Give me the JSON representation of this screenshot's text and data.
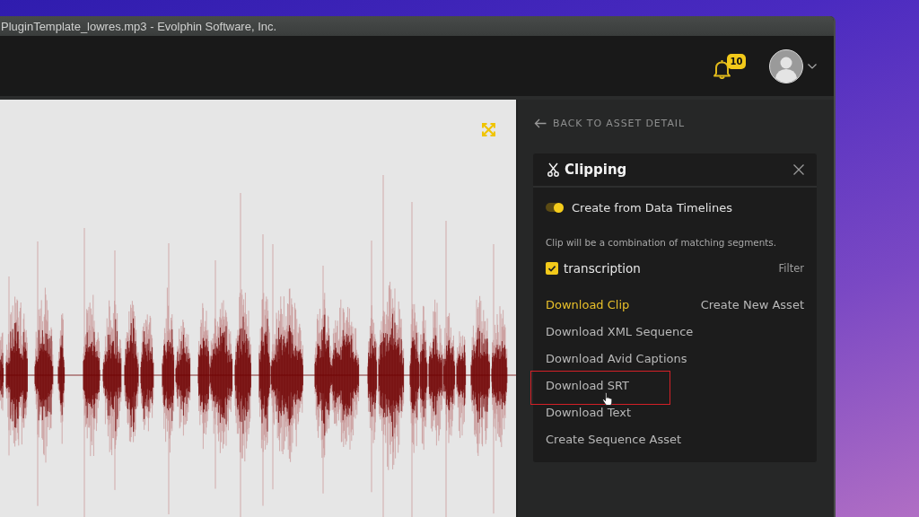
{
  "window": {
    "title": "PluginTemplate_lowres.mp3 - Evolphin Software, Inc."
  },
  "header": {
    "notifications": {
      "count": "10"
    }
  },
  "back_link": "BACK TO ASSET DETAIL",
  "clipping_panel": {
    "title": "Clipping",
    "toggle": {
      "label": "Create from Data Timelines",
      "on": true
    },
    "description": "Clip will be a combination of matching segments.",
    "timelines": [
      {
        "label": "transcription",
        "checked": true
      }
    ],
    "filter": "Filter",
    "actions": [
      {
        "label": "Download Clip",
        "selected": true,
        "highlighted": false,
        "hovered": false
      },
      {
        "label": "Download XML Sequence",
        "selected": false,
        "highlighted": false,
        "hovered": false
      },
      {
        "label": "Download Avid Captions",
        "selected": false,
        "highlighted": false,
        "hovered": false
      },
      {
        "label": "Download SRT",
        "selected": false,
        "highlighted": true,
        "hovered": true
      },
      {
        "label": "Download Text",
        "selected": false,
        "highlighted": false,
        "hovered": false
      },
      {
        "label": "Create Sequence Asset",
        "selected": false,
        "highlighted": false,
        "hovered": false
      }
    ],
    "create_asset": "Create New Asset"
  }
}
